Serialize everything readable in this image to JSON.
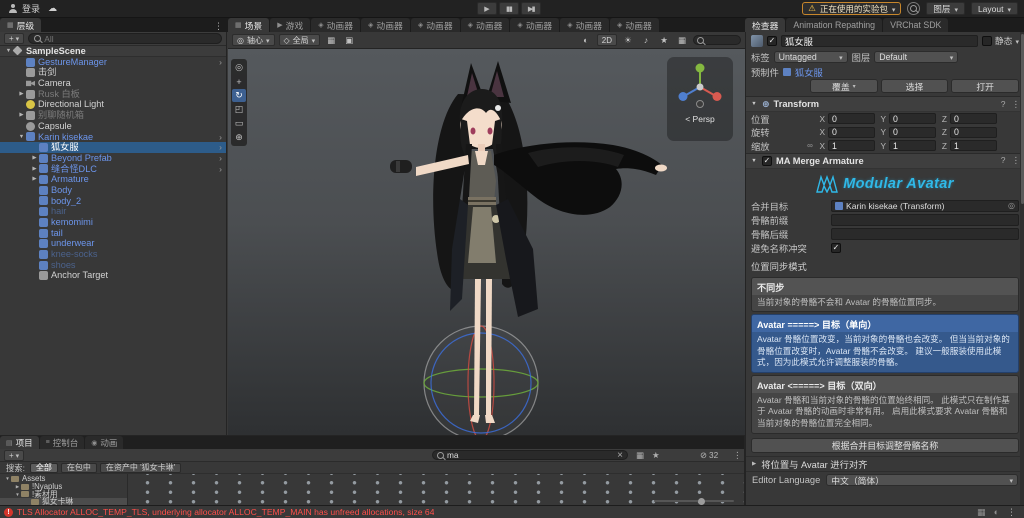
{
  "colors": {
    "selection_blue": "#2d5c8a",
    "prefab_text": "#6c95eb",
    "experimental_orange": "#c7862b",
    "error_red": "#ff4f4a",
    "modular_avatar_cyan": "#2fb9e8"
  },
  "topbar": {
    "login": "登录",
    "experimental": "正在使用的实验包",
    "layers": "图层",
    "layout": "Layout"
  },
  "tabs": {
    "hierarchy": "层级",
    "center": [
      "场景",
      "游戏",
      "动画器",
      "动画器",
      "动画器",
      "动画器",
      "动画器",
      "动画器",
      "动画器"
    ],
    "inspector": [
      "检查器",
      "Animation Repathing",
      "VRChat SDK"
    ]
  },
  "hierarchy": {
    "add_button": "+",
    "search_placeholder": "All",
    "items": [
      {
        "label": "SampleScene",
        "level": 0,
        "caret": "▼",
        "icon": "scene",
        "style": "scene"
      },
      {
        "label": "GestureManager",
        "level": 1,
        "caret": "",
        "icon": "cube-blue",
        "style": "prefab",
        "arrow": true
      },
      {
        "label": "击剑",
        "level": 1,
        "caret": "",
        "icon": "cube-gray",
        "style": "normal"
      },
      {
        "label": "Camera",
        "level": 1,
        "caret": "",
        "icon": "camera",
        "style": "normal"
      },
      {
        "label": "Rusk 白板",
        "level": 1,
        "caret": "▶",
        "icon": "cube-gray",
        "style": "dim"
      },
      {
        "label": "Directional Light",
        "level": 1,
        "caret": "",
        "icon": "light",
        "style": "normal"
      },
      {
        "label": "别聊随机箱",
        "level": 1,
        "caret": "▶",
        "icon": "cube-gray",
        "style": "dim"
      },
      {
        "label": "Capsule",
        "level": 1,
        "caret": "",
        "icon": "capsule",
        "style": "normal"
      },
      {
        "label": "Karin kisekae",
        "level": 1,
        "caret": "▼",
        "icon": "cube-blue",
        "style": "prefab",
        "arrow": true
      },
      {
        "label": "狐女服",
        "level": 2,
        "caret": "",
        "icon": "cube-blue",
        "style": "prefab",
        "selected": true,
        "arrow": true
      },
      {
        "label": "Beyond Prefab",
        "level": 2,
        "caret": "▶",
        "icon": "cube-blue",
        "style": "prefab",
        "arrow": true
      },
      {
        "label": "缝合怪DLC",
        "level": 2,
        "caret": "▶",
        "icon": "cube-blue",
        "style": "prefab",
        "arrow": true
      },
      {
        "label": "Armature",
        "level": 2,
        "caret": "▶",
        "icon": "cube-blue",
        "style": "prefab"
      },
      {
        "label": "Body",
        "level": 2,
        "caret": "",
        "icon": "cube-blue",
        "style": "prefab"
      },
      {
        "label": "body_2",
        "level": 2,
        "caret": "",
        "icon": "cube-blue",
        "style": "prefab"
      },
      {
        "label": "hair",
        "level": 2,
        "caret": "",
        "icon": "cube-blue",
        "style": "prefab-dim"
      },
      {
        "label": "kemomimi",
        "level": 2,
        "caret": "",
        "icon": "cube-blue",
        "style": "prefab"
      },
      {
        "label": "tail",
        "level": 2,
        "caret": "",
        "icon": "cube-blue",
        "style": "prefab"
      },
      {
        "label": "underwear",
        "level": 2,
        "caret": "",
        "icon": "cube-blue",
        "style": "prefab"
      },
      {
        "label": "knee-socks",
        "level": 2,
        "caret": "",
        "icon": "cube-blue",
        "style": "prefab-dim"
      },
      {
        "label": "shoes",
        "level": 2,
        "caret": "",
        "icon": "cube-blue",
        "style": "prefab-dim"
      },
      {
        "label": "Anchor Target",
        "level": 2,
        "caret": "",
        "icon": "cube-gray",
        "style": "normal"
      }
    ]
  },
  "scene": {
    "pivot": "轴心",
    "space": "全局",
    "two_d": "2D",
    "persp": "< Persp",
    "tools": [
      "view",
      "move",
      "rotate",
      "scale",
      "rect",
      "transform"
    ],
    "active_tool": 2
  },
  "inspector": {
    "name": "狐女服",
    "static_label": "静态",
    "tag_label": "标签",
    "tag_value": "Untagged",
    "layer_label": "图层",
    "layer_value": "Default",
    "prefab_label": "预制件",
    "prefab_name": "狐女服",
    "prefab_buttons": [
      "覆盖",
      "选择",
      "打开"
    ],
    "transform": {
      "title": "Transform",
      "axes": [
        "X",
        "Y",
        "Z"
      ],
      "rows": [
        {
          "label": "位置",
          "values": [
            "0",
            "0",
            "0"
          ]
        },
        {
          "label": "旋转",
          "values": [
            "0",
            "0",
            "0"
          ]
        },
        {
          "label": "缩放",
          "values": [
            "1",
            "1",
            "1"
          ],
          "link": true
        }
      ]
    },
    "ma": {
      "title": "MA Merge Armature",
      "logo": "Modular Avatar",
      "merge_target_label": "合并目标",
      "merge_target_value": "Karin kisekae (Transform)",
      "prefix_label": "骨骼前缀",
      "suffix_label": "骨骼后缀",
      "avoid_label": "避免名称冲突",
      "sync_label": "位置同步模式",
      "modes": [
        {
          "title": "不同步",
          "desc": "当前对象的骨骼不会和 Avatar 的骨骼位置同步。",
          "selected": false
        },
        {
          "title": "Avatar =====> 目标（单向）",
          "desc": "Avatar 骨骼位置改变，当前对象的骨骼也会改变。 但当当前对象的骨骼位置改变时，Avatar 骨骼不会改变。 建议一般服装使用此模式，因为此模式允许调整服装的骨骼。",
          "selected": true
        },
        {
          "title": "Avatar <=====> 目标（双向）",
          "desc": "Avatar 骨骼和当前对象的骨骼的位置始终相同。 此模式只在制作基于 Avatar 骨骼的动画时非常有用。 启用此模式要求 Avatar 骨骼和当前对象的骨骼位置完全相同。",
          "selected": false
        }
      ],
      "rename_button": "根据合并目标调整骨骼名称",
      "align_foldout": "将位置与 Avatar 进行对齐",
      "language_label": "Editor Language",
      "language_value": "中文（简体）"
    }
  },
  "project": {
    "tabs": [
      "项目",
      "控制台",
      "动画"
    ],
    "add_button": "+",
    "search_value": "ma",
    "scope_label": "搜索:",
    "scopes": [
      "全部",
      "在包中",
      "在资产中 '狐女卡琳'"
    ],
    "hidden_count": "32",
    "tree": [
      {
        "label": "Assets",
        "level": 0,
        "caret": "▼"
      },
      {
        "label": "!Nyaplus",
        "level": 1,
        "caret": "▶"
      },
      {
        "label": "!素材用",
        "level": 1,
        "caret": "▼"
      },
      {
        "label": "狐女卡琳",
        "level": 2,
        "caret": "",
        "selected": true
      }
    ]
  },
  "statusbar": {
    "message": "TLS Allocator ALLOC_TEMP_TLS, underlying allocator ALLOC_TEMP_MAIN has unfreed allocations, size 64"
  }
}
